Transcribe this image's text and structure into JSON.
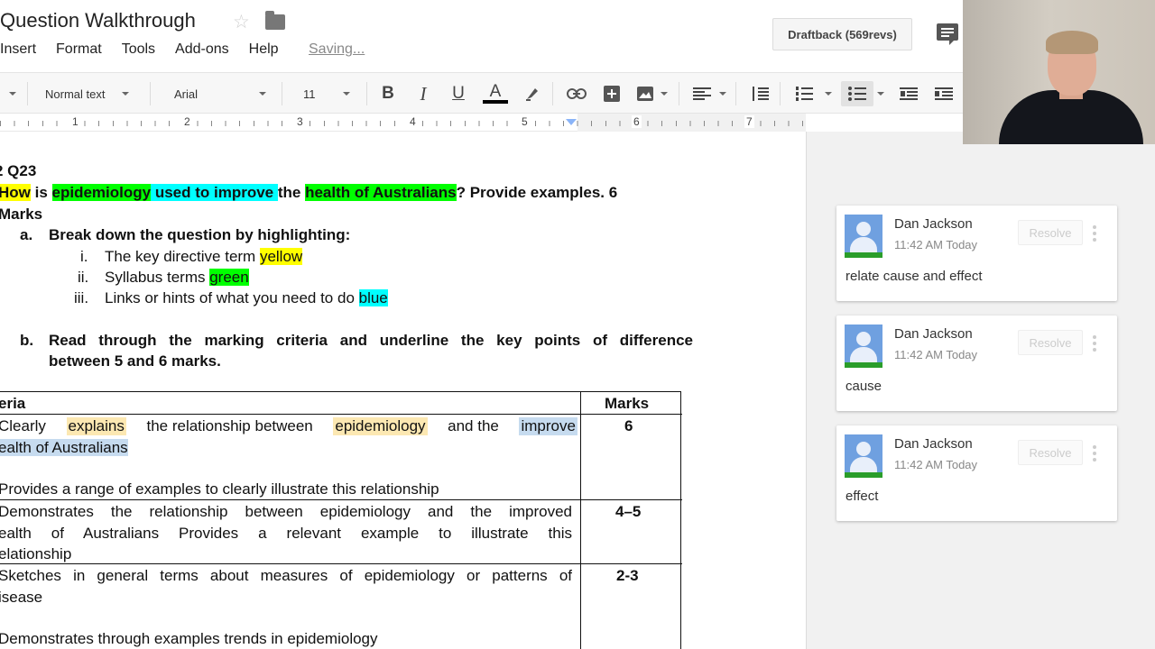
{
  "app": {
    "doc_title": "Question Walkthrough",
    "menus": [
      "Insert",
      "Format",
      "Tools",
      "Add-ons",
      "Help"
    ],
    "saving_status": "Saving...",
    "draftback_label": "Draftback (569revs)"
  },
  "toolbar": {
    "style": "Normal text",
    "font": "Arial",
    "size": "11",
    "bold": "B",
    "italic": "I",
    "underline": "U",
    "text_color": "A"
  },
  "ruler": {
    "numbers": [
      "1",
      "2",
      "3",
      "4",
      "5",
      "6",
      "7"
    ]
  },
  "doc": {
    "q_label": "2 Q23",
    "q_line1": {
      "p1": "How",
      "p2": " is ",
      "p3": "epidemiology",
      "p4": " used to improve ",
      "p5": " the ",
      "p6": "health of Australians",
      "p7": "? Provide examples. 6"
    },
    "q_line2": "Marks",
    "a_marker": "a.",
    "a_text": "Break down the question by highlighting:",
    "i_marker": "i.",
    "i_text": "The key directive term ",
    "i_hl": "yellow",
    "ii_marker": "ii.",
    "ii_text": "Syllabus terms ",
    "ii_hl": "green",
    "iii_marker": "iii.",
    "iii_text": "Links or hints of what you need to do ",
    "iii_hl": "blue",
    "b_marker": "b.",
    "b_line1": "Read through the marking criteria and underline the key points of difference",
    "b_line2": "between 5 and 6 marks.",
    "table": {
      "header_criteria": "eria",
      "header_marks": "Marks",
      "row1": {
        "l1": {
          "p1": "Clearly ",
          "p2": "explains",
          "p3": " the relationship between ",
          "p4": "epidemiology",
          "p5": " and the ",
          "p6": "improve"
        },
        "l2": "ealth of Australians",
        "l3": "Provides a range of examples to clearly illustrate this relationship",
        "mark": "6"
      },
      "row2": {
        "l1": "Demonstrates the relationship between epidemiology and the improved",
        "l2": "ealth of Australians Provides a relevant example to illustrate this",
        "l3": "elationship",
        "mark": "4–5"
      },
      "row3": {
        "l1": "Sketches in general terms about measures of epidemiology or patterns of",
        "l2": "isease",
        "l3": "Demonstrates through examples trends in epidemiology",
        "mark": "2-3"
      }
    }
  },
  "comments": [
    {
      "author": "Dan Jackson",
      "time": "11:42 AM Today",
      "resolve": "Resolve",
      "text": "relate cause and effect"
    },
    {
      "author": "Dan Jackson",
      "time": "11:42 AM Today",
      "resolve": "Resolve",
      "text": "cause"
    },
    {
      "author": "Dan Jackson",
      "time": "11:42 AM Today",
      "resolve": "Resolve",
      "text": "effect"
    }
  ],
  "colors": {
    "yellow": "#ffff00",
    "green": "#00ff00",
    "cyan": "#00ffff",
    "comment_highlight": "#fce8b2",
    "comment_selected": "#c6dbef",
    "text_color_bar": "#000000"
  },
  "icons": [
    "star-icon",
    "folder-icon",
    "comments-icon",
    "link-icon",
    "insert-comment-icon",
    "image-icon",
    "align-left-icon",
    "line-spacing-icon",
    "numbered-list-icon",
    "bulleted-list-icon",
    "decrease-indent-icon",
    "increase-indent-icon",
    "highlight-pen-icon"
  ]
}
